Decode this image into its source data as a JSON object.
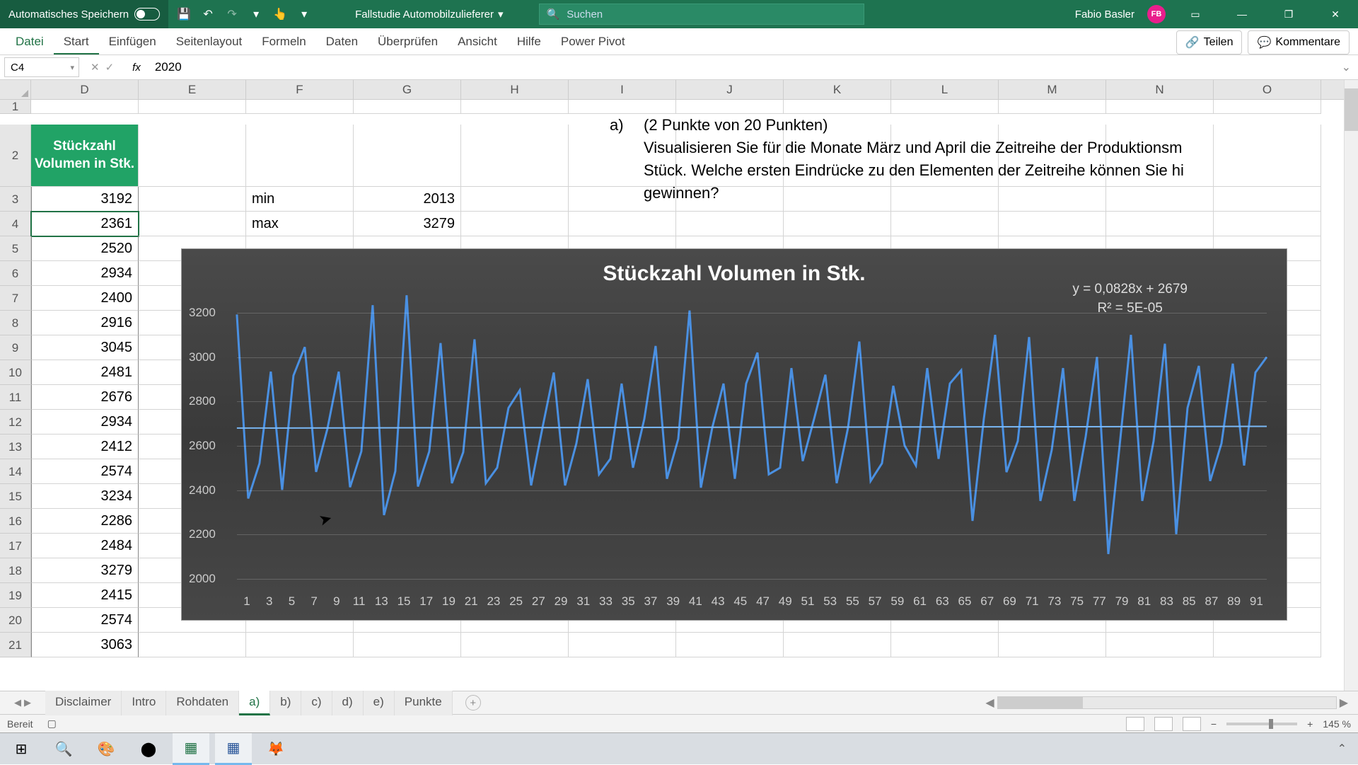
{
  "titlebar": {
    "autosave_label": "Automatisches Speichern",
    "filename": "Fallstudie Automobilzulieferer",
    "search_placeholder": "Suchen",
    "username": "Fabio Basler",
    "user_initials": "FB"
  },
  "ribbon": {
    "tabs": [
      "Datei",
      "Start",
      "Einfügen",
      "Seitenlayout",
      "Formeln",
      "Daten",
      "Überprüfen",
      "Ansicht",
      "Hilfe",
      "Power Pivot"
    ],
    "share": "Teilen",
    "comments": "Kommentare"
  },
  "formulabar": {
    "cell_ref": "C4",
    "formula": "2020"
  },
  "columns": [
    "D",
    "E",
    "F",
    "G",
    "H",
    "I",
    "J",
    "K",
    "L",
    "M",
    "N",
    "O"
  ],
  "col_header_label": "Stückzahl Volumen in Stk.",
  "stats": {
    "min_label": "min",
    "min_value": "2013",
    "max_label": "max",
    "max_value": "3279"
  },
  "data_values": [
    "3192",
    "2361",
    "2520",
    "2934",
    "2400",
    "2916",
    "3045",
    "2481",
    "2676",
    "2934",
    "2412",
    "2574",
    "3234",
    "2286",
    "2484",
    "3279",
    "2415",
    "2574",
    "3063"
  ],
  "row_numbers": [
    1,
    2,
    3,
    4,
    5,
    6,
    7,
    8,
    9,
    10,
    11,
    12,
    13,
    14,
    15,
    16,
    17,
    18,
    19,
    20,
    21
  ],
  "question": {
    "label": "a)",
    "points": "(2 Punkte von 20 Punkten)",
    "line1": "Visualisieren Sie für die Monate März und April die Zeitreihe der Produktionsm",
    "line2": "Stück. Welche ersten Eindrücke zu den Elementen der Zeitreihe können Sie hi",
    "line3": "gewinnen?"
  },
  "chart_data": {
    "type": "line",
    "title": "Stückzahl Volumen in Stk.",
    "equation": "y = 0,0828x + 2679",
    "r2": "R² = 5E-05",
    "ylim": [
      2000,
      3200
    ],
    "yticks": [
      2000,
      2200,
      2400,
      2600,
      2800,
      3000,
      3200
    ],
    "x_labels": [
      1,
      3,
      5,
      7,
      9,
      11,
      13,
      15,
      17,
      19,
      21,
      23,
      25,
      27,
      29,
      31,
      33,
      35,
      37,
      39,
      41,
      43,
      45,
      47,
      49,
      51,
      53,
      55,
      57,
      59,
      61,
      63,
      65,
      67,
      69,
      71,
      73,
      75,
      77,
      79,
      81,
      83,
      85,
      87,
      89,
      91
    ],
    "trendline": {
      "slope": 0.0828,
      "intercept": 2679
    },
    "values": [
      3192,
      2361,
      2520,
      2934,
      2400,
      2916,
      3045,
      2481,
      2676,
      2934,
      2412,
      2574,
      3234,
      2286,
      2484,
      3279,
      2415,
      2574,
      3063,
      2430,
      2570,
      3080,
      2430,
      2500,
      2770,
      2850,
      2420,
      2680,
      2930,
      2420,
      2610,
      2900,
      2470,
      2540,
      2880,
      2500,
      2720,
      3050,
      2450,
      2630,
      3210,
      2410,
      2680,
      2880,
      2450,
      2880,
      3020,
      2470,
      2500,
      2950,
      2530,
      2720,
      2920,
      2430,
      2680,
      3070,
      2440,
      2520,
      2870,
      2600,
      2510,
      2950,
      2540,
      2880,
      2940,
      2260,
      2720,
      3100,
      2480,
      2620,
      3090,
      2350,
      2580,
      2950,
      2350,
      2640,
      3000,
      2110,
      2600,
      3100,
      2350,
      2620,
      3060,
      2200,
      2770,
      2960,
      2440,
      2610,
      2970,
      2510,
      2930,
      3000
    ]
  },
  "sheet_tabs": [
    "Disclaimer",
    "Intro",
    "Rohdaten",
    "a)",
    "b)",
    "c)",
    "d)",
    "e)",
    "Punkte"
  ],
  "active_sheet": "a)",
  "statusbar": {
    "ready": "Bereit",
    "zoom": "145 %"
  }
}
